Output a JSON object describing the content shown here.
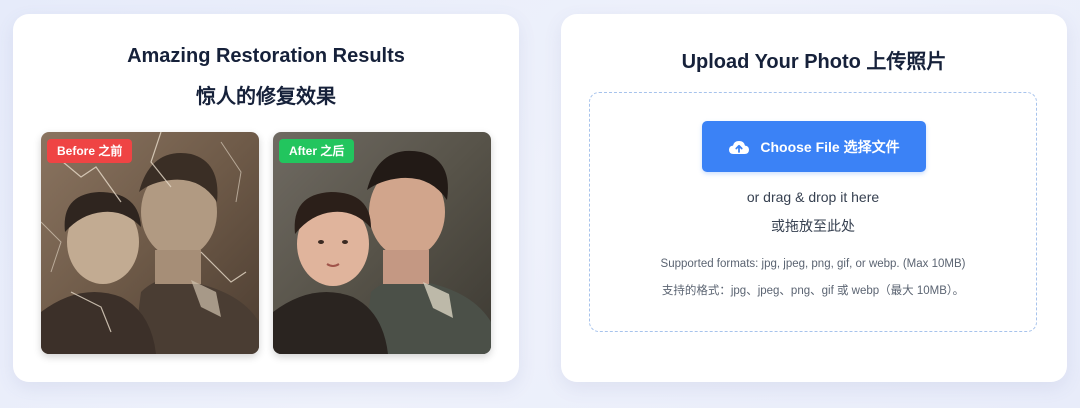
{
  "results": {
    "title_en": "Amazing Restoration Results",
    "title_zh": "惊人的修复效果",
    "before_badge": "Before  之前",
    "after_badge": "After  之后"
  },
  "upload": {
    "title": "Upload Your Photo  上传照片",
    "button_label": "Choose File  选择文件",
    "button_icon": "cloud-upload-icon",
    "drag_en": "or drag & drop it here",
    "drag_zh": "或拖放至此处",
    "formats_en": "Supported formats: jpg, jpeg, png, gif, or webp. (Max 10MB)",
    "formats_zh": "支持的格式：jpg、jpeg、png、gif 或 webp（最大 10MB）。"
  },
  "colors": {
    "accent_blue": "#3b82f6",
    "before_red": "#ef4444",
    "after_green": "#22c55e",
    "dashed_border": "#a7c3ec",
    "title_text": "#16213a"
  }
}
